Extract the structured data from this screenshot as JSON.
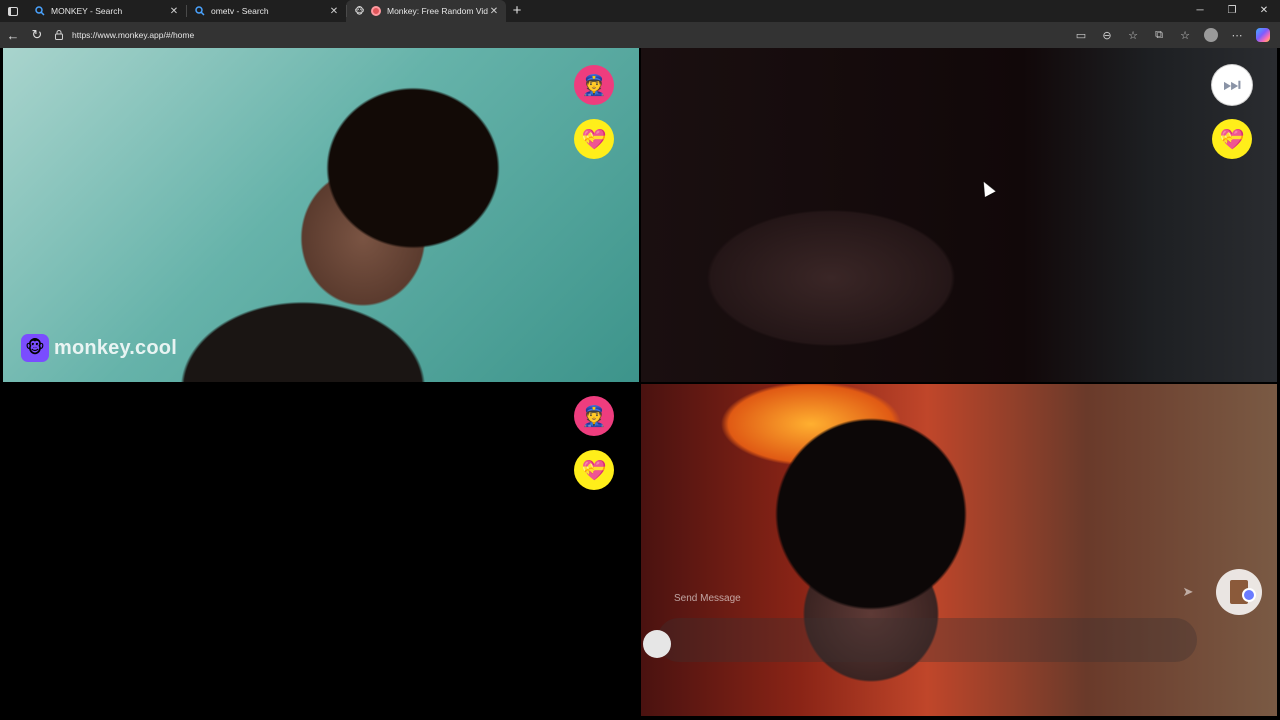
{
  "browser": {
    "tabs": [
      {
        "title": "MONKEY - Search",
        "icon": "search-icon",
        "active": false
      },
      {
        "title": "ometv - Search",
        "icon": "search-icon",
        "active": false
      },
      {
        "title": "Monkey: Free Random Video Chat",
        "icon": "monkey-favicon",
        "active": true
      }
    ],
    "new_tab_label": "+",
    "url": "https://www.monkey.app/#/home"
  },
  "app": {
    "logo_text": "monkey.cool",
    "message_placeholder": "Send Message",
    "buttons": {
      "report": "👮",
      "heart": "💝",
      "skip": "⏭"
    }
  },
  "colors": {
    "report_bg": "#ee3d7e",
    "heart_bg": "#ffee1a",
    "brand_purple": "#7a4dff"
  }
}
